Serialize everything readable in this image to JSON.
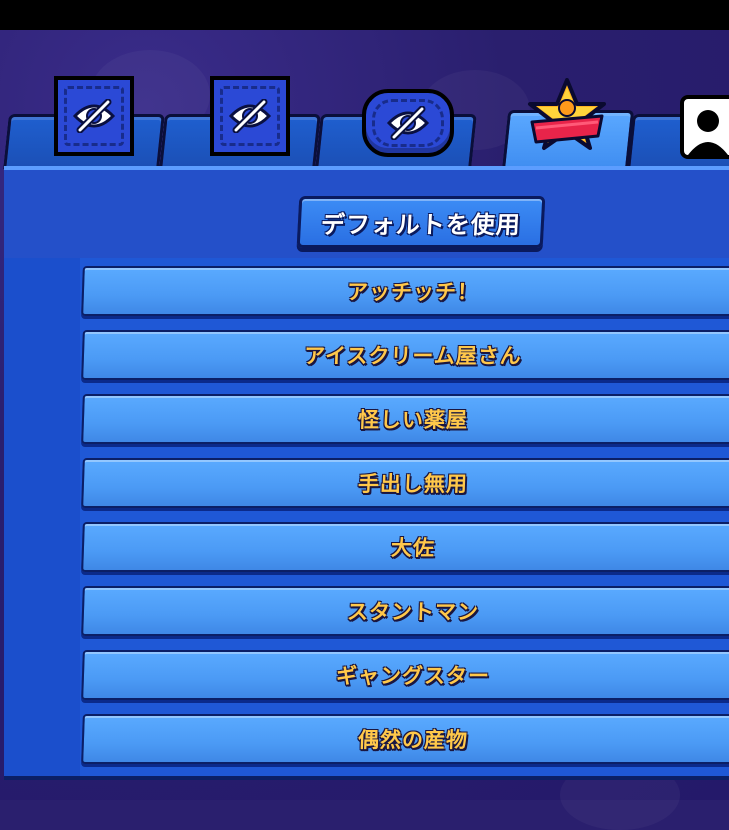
{
  "default_button": {
    "label": "デフォルトを使用"
  },
  "icons": {
    "hidden_slot": "eye-slash-icon",
    "star_profile": "star-player-icon",
    "profile_card": "player-profile-icon"
  },
  "colors": {
    "panel": "#1f58d6",
    "item": "#4b9af5",
    "item_text": "#ffc84a",
    "background": "#2a1f6e"
  },
  "titles": [
    {
      "label": "アッチッチ！"
    },
    {
      "label": "アイスクリーム屋さん"
    },
    {
      "label": "怪しい薬屋"
    },
    {
      "label": "手出し無用"
    },
    {
      "label": "大佐"
    },
    {
      "label": "スタントマン"
    },
    {
      "label": "ギャングスター"
    },
    {
      "label": "偶然の産物"
    }
  ]
}
